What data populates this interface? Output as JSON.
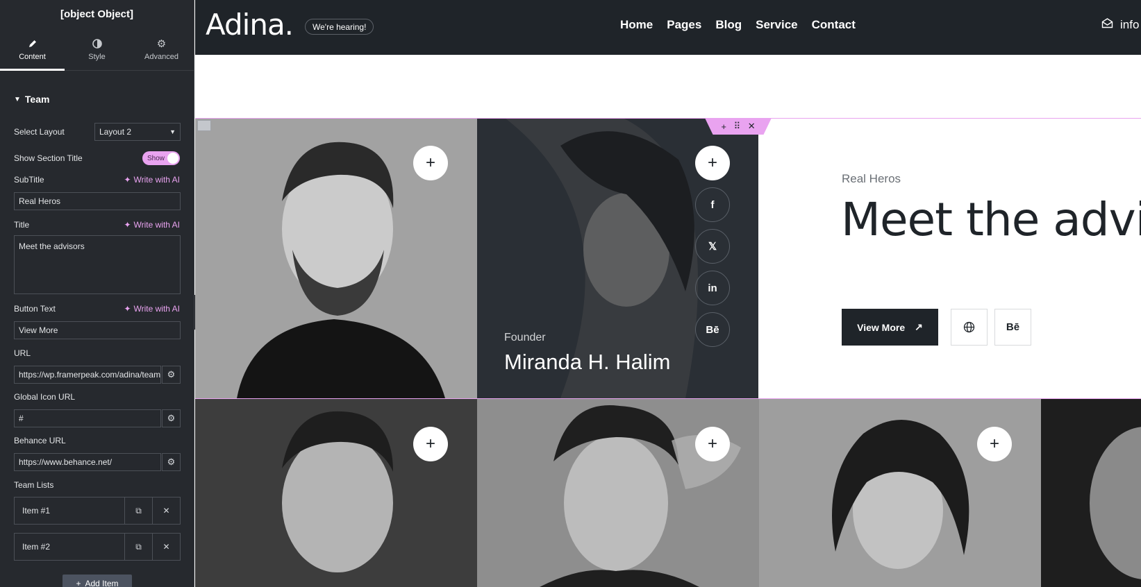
{
  "editor": {
    "title": {
      "label": "Title",
      "value": "Meet the advisors"
    },
    "tabs": [
      {
        "label": "Content",
        "icon": "pencil-icon"
      },
      {
        "label": "Style",
        "icon": "half-circle-icon"
      },
      {
        "label": "Advanced",
        "icon": "gear-icon"
      }
    ],
    "section": "Team",
    "select_layout": {
      "label": "Select Layout",
      "value": "Layout 2"
    },
    "show_title": {
      "label": "Show Section Title",
      "toggle_text": "Show"
    },
    "ai_label": "Write with AI",
    "subtitle": {
      "label": "SubTitle",
      "value": "Real Heros"
    },
    "button_text": {
      "label": "Button Text",
      "value": "View More"
    },
    "url": {
      "label": "URL",
      "value": "https://wp.framerpeak.com/adina/team"
    },
    "global_icon_url": {
      "label": "Global Icon URL",
      "value": "#"
    },
    "behance_url": {
      "label": "Behance URL",
      "value": "https://www.behance.net/"
    },
    "team_lists": {
      "label": "Team Lists",
      "items": [
        "Item #1",
        "Item #2"
      ]
    },
    "add_item": "Add Item"
  },
  "site": {
    "logo": "Adina.",
    "pill": "We're hearing!",
    "menu": [
      "Home",
      "Pages",
      "Blog",
      "Service",
      "Contact"
    ],
    "mail_text": "info",
    "featured": {
      "role": "Founder",
      "name": "Miranda H. Halim"
    },
    "social": [
      "f",
      "𝕏",
      "in",
      "Bē"
    ],
    "section": {
      "subtitle": "Real Heros",
      "title": "Meet the advisors",
      "button": "View More",
      "behance": "Bē"
    },
    "handle_icons": [
      "+",
      "⠿",
      "✕"
    ]
  }
}
